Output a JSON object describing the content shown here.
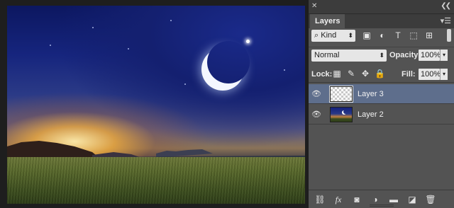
{
  "panel": {
    "collapse_icon": "close-x-icon",
    "expand_icon": "double-chevron-icon",
    "tab_label": "Layers",
    "menu_icon": "panel-menu-icon",
    "filter": {
      "kind_label": "Kind",
      "icons": [
        "pixel-filter-icon",
        "adjustment-filter-icon",
        "type-filter-icon",
        "shape-filter-icon",
        "smart-object-filter-icon"
      ]
    },
    "blend_mode": "Normal",
    "opacity_label": "Opacity:",
    "opacity_value": "100%",
    "lock_label": "Lock:",
    "fill_label": "Fill:",
    "fill_value": "100%",
    "layers": [
      {
        "name": "Layer 3",
        "selected": true,
        "visible": true,
        "thumbnail": "transparent"
      },
      {
        "name": "Layer 2",
        "selected": false,
        "visible": true,
        "thumbnail": "night-sky-photo"
      }
    ],
    "bottom_icons": [
      "link-layers-icon",
      "fx-icon",
      "mask-icon",
      "adjustment-layer-icon",
      "folder-icon",
      "new-layer-icon",
      "trash-icon"
    ]
  },
  "colors": {
    "panel_bg": "#535353",
    "selected_layer": "#5e6e8c",
    "header_bg": "#3c3c3c"
  }
}
